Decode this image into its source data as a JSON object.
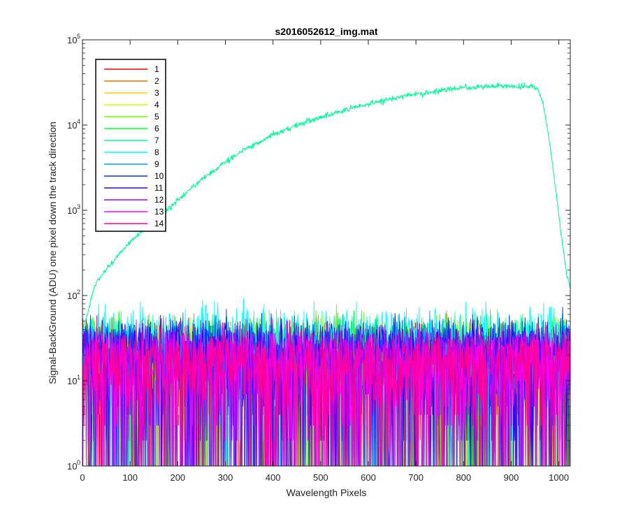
{
  "chart_data": {
    "type": "line",
    "title": "s2016052612_img.mat",
    "xlabel": "Wavelength Pixels",
    "ylabel": "Signal-BackGround (ADU) one pixel down the track direction",
    "xlim": [
      0,
      1024
    ],
    "ylim": [
      1,
      100000
    ],
    "yscale": "log",
    "x_ticks": [
      0,
      100,
      200,
      300,
      400,
      500,
      600,
      700,
      800,
      900,
      1000
    ],
    "y_ticks": [
      {
        "value": 1,
        "base": "10",
        "exp": "0"
      },
      {
        "value": 10,
        "base": "10",
        "exp": "1"
      },
      {
        "value": 100,
        "base": "10",
        "exp": "2"
      },
      {
        "value": 1000,
        "base": "10",
        "exp": "3"
      },
      {
        "value": 10000,
        "base": "10",
        "exp": "4"
      },
      {
        "value": 100000,
        "base": "10",
        "exp": "5"
      }
    ],
    "grid": false,
    "legend": "top-left",
    "series": [
      {
        "name": "1",
        "color": "#ff0000",
        "level": 18
      },
      {
        "name": "2",
        "color": "#ff6a00",
        "level": 18
      },
      {
        "name": "3",
        "color": "#ffcc00",
        "level": 18
      },
      {
        "name": "4",
        "color": "#ccff00",
        "level": 20
      },
      {
        "name": "5",
        "color": "#66ff00",
        "level": 22
      },
      {
        "name": "6",
        "color": "#00ff33",
        "level": 22
      },
      {
        "name": "7",
        "color": "#00ff99",
        "x": [
          0,
          10,
          20,
          30,
          50,
          75,
          100,
          125,
          150,
          175,
          200,
          250,
          300,
          350,
          400,
          450,
          500,
          550,
          600,
          650,
          700,
          750,
          800,
          850,
          880,
          900,
          930,
          945,
          955,
          965,
          975,
          985,
          995,
          1005,
          1015,
          1024
        ],
        "values": [
          40,
          60,
          100,
          150,
          200,
          300,
          420,
          580,
          780,
          1000,
          1300,
          2300,
          3700,
          5500,
          7700,
          9900,
          12500,
          15000,
          17800,
          20500,
          23200,
          25500,
          27200,
          28500,
          29000,
          28600,
          28200,
          28200,
          26500,
          20000,
          10000,
          4000,
          1500,
          500,
          200,
          120
        ]
      },
      {
        "name": "8",
        "color": "#00ffff",
        "level": 30
      },
      {
        "name": "9",
        "color": "#0099ff",
        "level": 20
      },
      {
        "name": "10",
        "color": "#0033ff",
        "level": 22
      },
      {
        "name": "11",
        "color": "#3300ff",
        "level": 20
      },
      {
        "name": "12",
        "color": "#9900ff",
        "level": 18
      },
      {
        "name": "13",
        "color": "#ff00ff",
        "level": 16
      },
      {
        "name": "14",
        "color": "#ff0099",
        "level": 16
      }
    ]
  }
}
